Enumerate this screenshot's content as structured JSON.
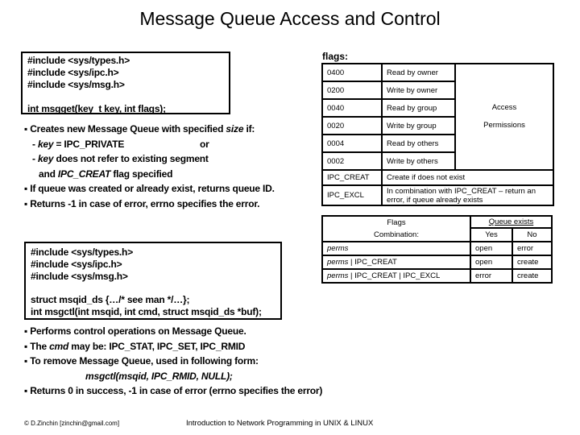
{
  "title": "Message Queue Access and Control",
  "msgget_box": {
    "lines": [
      "#include <sys/types.h>",
      "#include <sys/ipc.h>",
      "#include <sys/msg.h>"
    ],
    "signature": "int msgget(key_t key, int flags);"
  },
  "msgget_bullets": {
    "b1_pre": "▪ Creates new Message Queue with specified ",
    "b1_ital": "size",
    "b1_post": " if:",
    "b2_ital": "key",
    "b2_post": " = IPC_PRIVATE",
    "b2_or": "or",
    "b3_ital": "key",
    "b3_post": " does not refer to existing segment",
    "b4_pre": "and ",
    "b4_ital": "IPC_CREAT",
    "b4_post": " flag specified",
    "b5": "▪ If queue was created or already exist, returns queue ID.",
    "b6": "▪ Returns -1 in case of error, errno specifies the error."
  },
  "flags_label": "flags:",
  "flags_table": {
    "rows": [
      {
        "code": "0400",
        "desc": "Read by owner"
      },
      {
        "code": "0200",
        "desc": "Write by owner"
      },
      {
        "code": "0040",
        "desc": "Read by group"
      },
      {
        "code": "0020",
        "desc": "Write by group"
      },
      {
        "code": "0004",
        "desc": "Read by others"
      },
      {
        "code": "0002",
        "desc": "Write by others"
      }
    ],
    "group_label_1": "Access",
    "group_label_2": "Permissions",
    "ipc_creat": {
      "code": "IPC_CREAT",
      "desc": "Create if does not exist"
    },
    "ipc_excl": {
      "code": "IPC_EXCL",
      "desc": "In combination with IPC_CREAT – return an error, if queue already exists"
    }
  },
  "combo_table": {
    "header_1": "Flags",
    "header_2": "Combination:",
    "queue_exists": "Queue exists",
    "yes": "Yes",
    "no": "No",
    "rows": [
      {
        "perms": "perms",
        "rest": "",
        "yes": "open",
        "no": "error"
      },
      {
        "perms": "perms",
        "rest": " | IPC_CREAT",
        "yes": "open",
        "no": "create"
      },
      {
        "perms": "perms",
        "rest": " | IPC_CREAT | IPC_EXCL",
        "yes": "error",
        "no": "create"
      }
    ]
  },
  "msgctl_box": {
    "lines": [
      "#include <sys/types.h>",
      "#include <sys/ipc.h>",
      "#include <sys/msg.h>"
    ],
    "struct_line": "struct msqid_ds {…/* see man */…};",
    "signature": "int msgctl(int msqid, int cmd, struct msqid_ds *buf);"
  },
  "msgctl_bullets": {
    "b1": "▪ Performs control operations on Message Queue.",
    "b2_pre": "▪ The ",
    "b2_ital": "cmd",
    "b2_post": " may be: IPC_STAT, IPC_SET, IPC_RMID",
    "b3": "▪ To remove Message Queue, used in following form:",
    "b4": "msgctl(msqid,  IPC_RMID,  NULL);",
    "b5": "▪ Returns 0 in success, -1 in case of error (errno specifies the error)"
  },
  "footer": {
    "author": "© D.Zinchin [zinchin@gmail.com]",
    "course": "Introduction to Network Programming in UNIX & LINUX"
  }
}
